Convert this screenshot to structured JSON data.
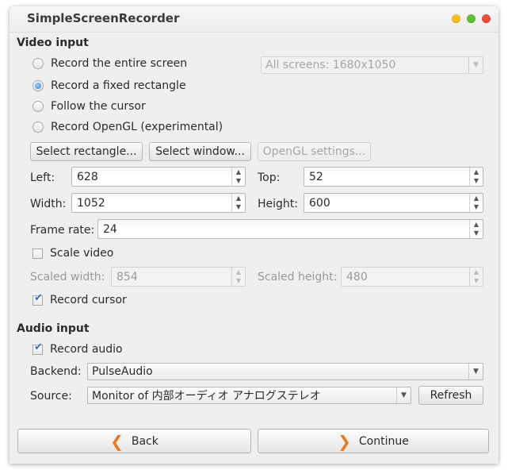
{
  "window": {
    "title": "SimpleScreenRecorder"
  },
  "video": {
    "section_title": "Video input",
    "options": [
      {
        "label": "Record the entire screen",
        "selected": false
      },
      {
        "label": "Record a fixed rectangle",
        "selected": true
      },
      {
        "label": "Follow the cursor",
        "selected": false
      },
      {
        "label": "Record OpenGL (experimental)",
        "selected": false
      }
    ],
    "screens_combo": "All screens: 1680x1050",
    "buttons": {
      "select_rectangle": "Select rectangle...",
      "select_window": "Select window...",
      "opengl_settings": "OpenGL settings..."
    },
    "left_label": "Left:",
    "left_value": "628",
    "top_label": "Top:",
    "top_value": "52",
    "width_label": "Width:",
    "width_value": "1052",
    "height_label": "Height:",
    "height_value": "600",
    "framerate_label": "Frame rate:",
    "framerate_value": "24",
    "scale_label": "Scale video",
    "scale_checked": false,
    "scaled_width_label": "Scaled width:",
    "scaled_width_value": "854",
    "scaled_height_label": "Scaled height:",
    "scaled_height_value": "480",
    "cursor_label": "Record cursor",
    "cursor_checked": true
  },
  "audio": {
    "section_title": "Audio input",
    "record_label": "Record audio",
    "record_checked": true,
    "backend_label": "Backend:",
    "backend_value": "PulseAudio",
    "source_label": "Source:",
    "source_value": "Monitor of 内部オーディオ アナログステレオ",
    "refresh_label": "Refresh"
  },
  "nav": {
    "back_label": "Back",
    "continue_label": "Continue"
  },
  "icons": {
    "back": "chevron-left-icon",
    "continue": "chevron-right-icon"
  },
  "colors": {
    "accent_radio": "#2f7fd6",
    "nav_icon": "#e87a1f"
  }
}
